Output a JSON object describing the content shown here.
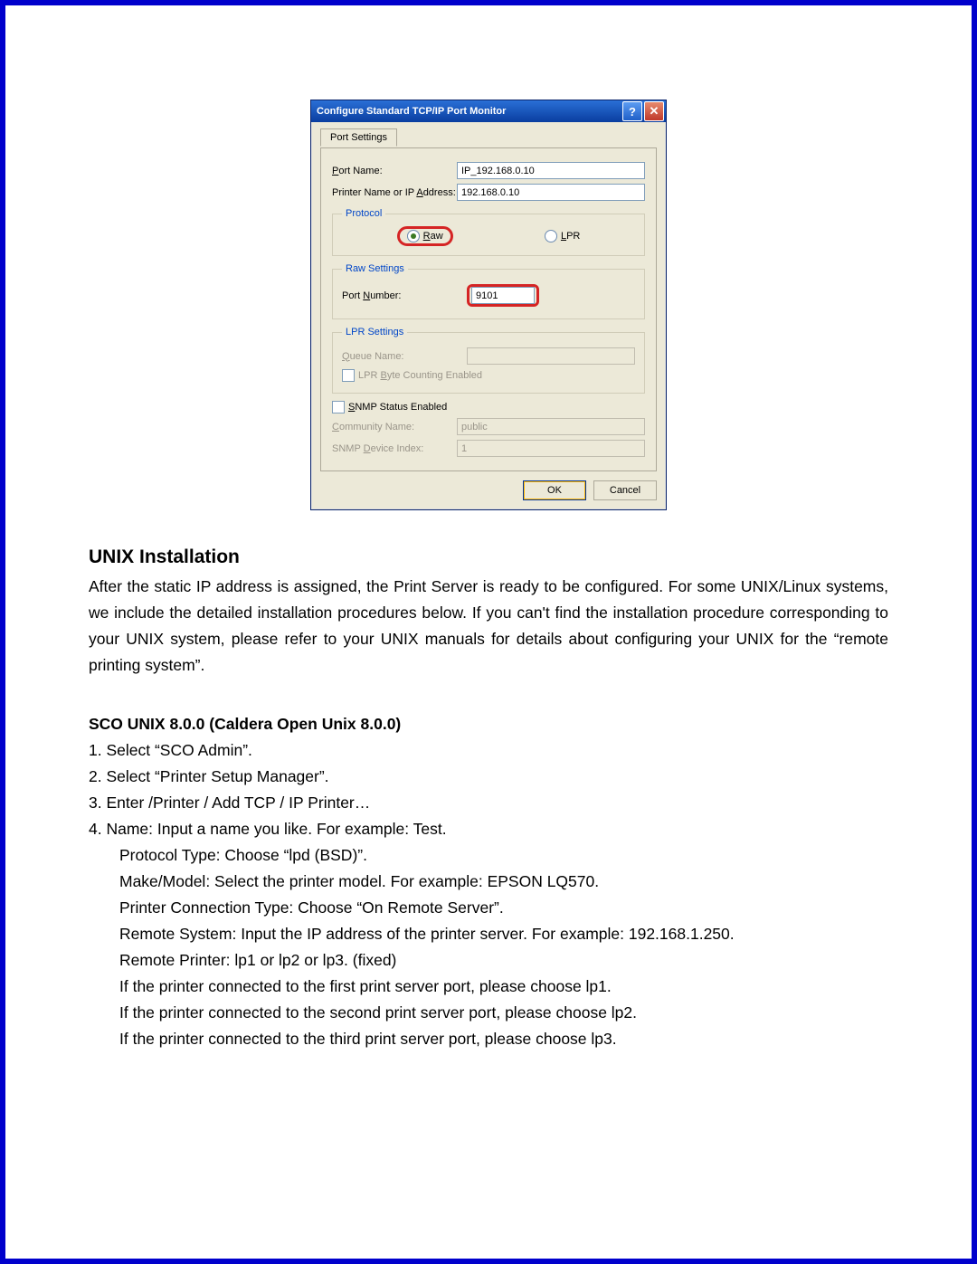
{
  "dialog": {
    "title": "Configure Standard TCP/IP Port Monitor",
    "tab": "Port Settings",
    "portNameLabel": "Port Name:",
    "portNameValue": "IP_192.168.0.10",
    "printerAddrLabel": "Printer Name or IP Address:",
    "printerAddrValue": "192.168.0.10",
    "protocolLegend": "Protocol",
    "protoRaw": "Raw",
    "protoLpr": "LPR",
    "rawLegend": "Raw Settings",
    "portNumberLabel": "Port Number:",
    "portNumberValue": "9101",
    "lprLegend": "LPR Settings",
    "queueLabel": "Queue Name:",
    "queueValue": "",
    "lprByte": "LPR Byte Counting Enabled",
    "snmpLabel": "SNMP Status Enabled",
    "communityLabel": "Community Name:",
    "communityValue": "public",
    "deviceIndexLabel": "SNMP Device Index:",
    "deviceIndexValue": "1",
    "ok": "OK",
    "cancel": "Cancel"
  },
  "doc": {
    "heading": "UNIX Installation",
    "para": "After the static IP address is assigned, the Print Server is ready to be configured. For some UNIX/Linux systems, we include the detailed installation procedures below. If you can't find the installation procedure corresponding to your UNIX system, please refer to your UNIX manuals for details about configuring your UNIX for the “remote printing system”.",
    "subheading": "SCO UNIX 8.0.0 (Caldera Open Unix 8.0.0)",
    "s1": "1. Select “SCO Admin”.",
    "s2": "2. Select “Printer Setup Manager”.",
    "s3": "3. Enter /Printer / Add TCP / IP Printer…",
    "s4": "4. Name: Input a name you like. For example: Test.",
    "s4a": "Protocol Type: Choose “lpd (BSD)”.",
    "s4b": "Make/Model: Select the printer model. For example: EPSON LQ570.",
    "s4c": "Printer Connection Type: Choose “On Remote Server”.",
    "s4d": "Remote System: Input the IP address of the printer server. For example: 192.168.1.250.",
    "s4e": "Remote Printer: lp1 or lp2 or lp3. (fixed)",
    "s4f": "If the printer connected to the first print server port, please choose lp1.",
    "s4g": "If the printer connected to the second print server port, please choose lp2.",
    "s4h": "If the printer connected to the third print server port, please choose lp3."
  }
}
